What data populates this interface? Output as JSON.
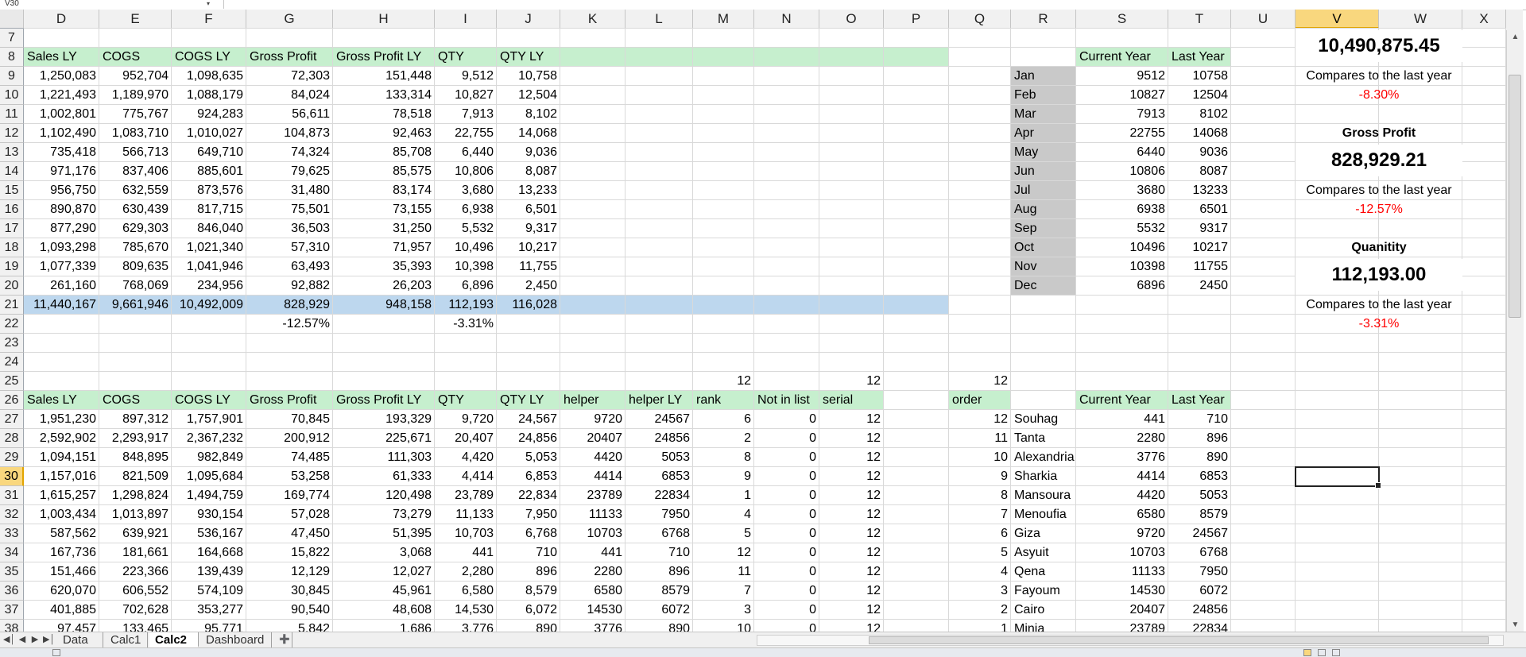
{
  "name_box": "V30",
  "columns": [
    "D",
    "E",
    "F",
    "G",
    "H",
    "I",
    "J",
    "K",
    "L",
    "M",
    "N",
    "O",
    "P",
    "Q",
    "R",
    "S",
    "T",
    "U",
    "V",
    "W",
    "X"
  ],
  "rows": [
    "7",
    "8",
    "9",
    "10",
    "11",
    "12",
    "13",
    "14",
    "15",
    "16",
    "17",
    "18",
    "19",
    "20",
    "21",
    "22",
    "23",
    "24",
    "25",
    "26",
    "27",
    "28",
    "29",
    "30",
    "31",
    "32",
    "33",
    "34",
    "35",
    "36",
    "37",
    "38"
  ],
  "active_cell": "V30",
  "colors": {
    "header_green": "#c6efce",
    "total_blue": "#bdd7ee",
    "month_gray": "#c9c9c9",
    "negative": "#ff0000"
  },
  "cells": {
    "D8": "Sales LY",
    "E8": "COGS",
    "F8": "COGS LY",
    "G8": "Gross Profit",
    "H8": "Gross Profit LY",
    "I8": "QTY",
    "J8": "QTY LY",
    "D9": "1,250,083",
    "E9": "952,704",
    "F9": "1,098,635",
    "G9": "72,303",
    "H9": "151,448",
    "I9": "9,512",
    "J9": "10,758",
    "D10": "1,221,493",
    "E10": "1,189,970",
    "F10": "1,088,179",
    "G10": "84,024",
    "H10": "133,314",
    "I10": "10,827",
    "J10": "12,504",
    "D11": "1,002,801",
    "E11": "775,767",
    "F11": "924,283",
    "G11": "56,611",
    "H11": "78,518",
    "I11": "7,913",
    "J11": "8,102",
    "D12": "1,102,490",
    "E12": "1,083,710",
    "F12": "1,010,027",
    "G12": "104,873",
    "H12": "92,463",
    "I12": "22,755",
    "J12": "14,068",
    "D13": "735,418",
    "E13": "566,713",
    "F13": "649,710",
    "G13": "74,324",
    "H13": "85,708",
    "I13": "6,440",
    "J13": "9,036",
    "D14": "971,176",
    "E14": "837,406",
    "F14": "885,601",
    "G14": "79,625",
    "H14": "85,575",
    "I14": "10,806",
    "J14": "8,087",
    "D15": "956,750",
    "E15": "632,559",
    "F15": "873,576",
    "G15": "31,480",
    "H15": "83,174",
    "I15": "3,680",
    "J15": "13,233",
    "D16": "890,870",
    "E16": "630,439",
    "F16": "817,715",
    "G16": "75,501",
    "H16": "73,155",
    "I16": "6,938",
    "J16": "6,501",
    "D17": "877,290",
    "E17": "629,303",
    "F17": "846,040",
    "G17": "36,503",
    "H17": "31,250",
    "I17": "5,532",
    "J17": "9,317",
    "D18": "1,093,298",
    "E18": "785,670",
    "F18": "1,021,340",
    "G18": "57,310",
    "H18": "71,957",
    "I18": "10,496",
    "J18": "10,217",
    "D19": "1,077,339",
    "E19": "809,635",
    "F19": "1,041,946",
    "G19": "63,493",
    "H19": "35,393",
    "I19": "10,398",
    "J19": "11,755",
    "D20": "261,160",
    "E20": "768,069",
    "F20": "234,956",
    "G20": "92,882",
    "H20": "26,203",
    "I20": "6,896",
    "J20": "2,450",
    "D21": "11,440,167",
    "E21": "9,661,946",
    "F21": "10,492,009",
    "G21": "828,929",
    "H21": "948,158",
    "I21": "112,193",
    "J21": "116,028",
    "G22": "-12.57%",
    "I22": "-3.31%",
    "M25": "12",
    "O25": "12",
    "Q25": "12",
    "D26": "Sales LY",
    "E26": "COGS",
    "F26": "COGS LY",
    "G26": "Gross Profit",
    "H26": "Gross Profit LY",
    "I26": "QTY",
    "J26": "QTY LY",
    "K26": "helper",
    "L26": "helper LY",
    "M26": "rank",
    "N26": "Not in list",
    "O26": "serial",
    "Q26": "order",
    "D27": "1,951,230",
    "E27": "897,312",
    "F27": "1,757,901",
    "G27": "70,845",
    "H27": "193,329",
    "I27": "9,720",
    "J27": "24,567",
    "K27": "9720",
    "L27": "24567",
    "M27": "6",
    "N27": "0",
    "O27": "12",
    "D28": "2,592,902",
    "E28": "2,293,917",
    "F28": "2,367,232",
    "G28": "200,912",
    "H28": "225,671",
    "I28": "20,407",
    "J28": "24,856",
    "K28": "20407",
    "L28": "24856",
    "M28": "2",
    "N28": "0",
    "O28": "12",
    "D29": "1,094,151",
    "E29": "848,895",
    "F29": "982,849",
    "G29": "74,485",
    "H29": "111,303",
    "I29": "4,420",
    "J29": "5,053",
    "K29": "4420",
    "L29": "5053",
    "M29": "8",
    "N29": "0",
    "O29": "12",
    "D30": "1,157,016",
    "E30": "821,509",
    "F30": "1,095,684",
    "G30": "53,258",
    "H30": "61,333",
    "I30": "4,414",
    "J30": "6,853",
    "K30": "4414",
    "L30": "6853",
    "M30": "9",
    "N30": "0",
    "O30": "12",
    "D31": "1,615,257",
    "E31": "1,298,824",
    "F31": "1,494,759",
    "G31": "169,774",
    "H31": "120,498",
    "I31": "23,789",
    "J31": "22,834",
    "K31": "23789",
    "L31": "22834",
    "M31": "1",
    "N31": "0",
    "O31": "12",
    "D32": "1,003,434",
    "E32": "1,013,897",
    "F32": "930,154",
    "G32": "57,028",
    "H32": "73,279",
    "I32": "11,133",
    "J32": "7,950",
    "K32": "11133",
    "L32": "7950",
    "M32": "4",
    "N32": "0",
    "O32": "12",
    "D33": "587,562",
    "E33": "639,921",
    "F33": "536,167",
    "G33": "47,450",
    "H33": "51,395",
    "I33": "10,703",
    "J33": "6,768",
    "K33": "10703",
    "L33": "6768",
    "M33": "5",
    "N33": "0",
    "O33": "12",
    "D34": "167,736",
    "E34": "181,661",
    "F34": "164,668",
    "G34": "15,822",
    "H34": "3,068",
    "I34": "441",
    "J34": "710",
    "K34": "441",
    "L34": "710",
    "M34": "12",
    "N34": "0",
    "O34": "12",
    "D35": "151,466",
    "E35": "223,366",
    "F35": "139,439",
    "G35": "12,129",
    "H35": "12,027",
    "I35": "2,280",
    "J35": "896",
    "K35": "2280",
    "L35": "896",
    "M35": "11",
    "N35": "0",
    "O35": "12",
    "D36": "620,070",
    "E36": "606,552",
    "F36": "574,109",
    "G36": "30,845",
    "H36": "45,961",
    "I36": "6,580",
    "J36": "8,579",
    "K36": "6580",
    "L36": "8579",
    "M36": "7",
    "N36": "0",
    "O36": "12",
    "D37": "401,885",
    "E37": "702,628",
    "F37": "353,277",
    "G37": "90,540",
    "H37": "48,608",
    "I37": "14,530",
    "J37": "6,072",
    "K37": "14530",
    "L37": "6072",
    "M37": "3",
    "N37": "0",
    "O37": "12",
    "D38": "97,457",
    "E38": "133,465",
    "F38": "95,771",
    "G38": "5,842",
    "H38": "1,686",
    "I38": "3,776",
    "J38": "890",
    "K38": "3776",
    "L38": "890",
    "M38": "10",
    "N38": "0",
    "O38": "12",
    "S8": "Current Year",
    "T8": "Last Year",
    "R9": "Jan",
    "S9": "9512",
    "T9": "10758",
    "R10": "Feb",
    "S10": "10827",
    "T10": "12504",
    "R11": "Mar",
    "S11": "7913",
    "T11": "8102",
    "R12": "Apr",
    "S12": "22755",
    "T12": "14068",
    "R13": "May",
    "S13": "6440",
    "T13": "9036",
    "R14": "Jun",
    "S14": "10806",
    "T14": "8087",
    "R15": "Jul",
    "S15": "3680",
    "T15": "13233",
    "R16": "Aug",
    "S16": "6938",
    "T16": "6501",
    "R17": "Sep",
    "S17": "5532",
    "T17": "9317",
    "R18": "Oct",
    "S18": "10496",
    "T18": "10217",
    "R19": "Nov",
    "S19": "10398",
    "T19": "11755",
    "R20": "Dec",
    "S20": "6896",
    "T20": "2450",
    "S26": "Current Year",
    "T26": "Last Year",
    "Q27": "12",
    "R27": "Souhag",
    "S27": "441",
    "T27": "710",
    "Q28": "11",
    "R28": "Tanta",
    "S28": "2280",
    "T28": "896",
    "Q29": "10",
    "R29": "Alexandria",
    "S29": "3776",
    "T29": "890",
    "Q30": "9",
    "R30": "Sharkia",
    "S30": "4414",
    "T30": "6853",
    "Q31": "8",
    "R31": "Mansoura",
    "S31": "4420",
    "T31": "5053",
    "Q32": "7",
    "R32": "Menoufia",
    "S32": "6580",
    "T32": "8579",
    "Q33": "6",
    "R33": "Giza",
    "S33": "9720",
    "T33": "24567",
    "Q34": "5",
    "R34": "Asyuit",
    "S34": "10703",
    "T34": "6768",
    "Q35": "4",
    "R35": "Qena",
    "S35": "11133",
    "T35": "7950",
    "Q36": "3",
    "R36": "Fayoum",
    "S36": "14530",
    "T36": "6072",
    "Q37": "2",
    "R37": "Cairo",
    "S37": "20407",
    "T37": "24856",
    "Q38": "1",
    "R38": "Minia",
    "S38": "23789",
    "T38": "22834"
  },
  "kpi": {
    "sales_value": "10,490,875.45",
    "sales_compare": "Compares to the last year",
    "sales_pct": "-8.30%",
    "gp_title": "Gross Profit",
    "gp_value": "828,929.21",
    "gp_compare": "Compares to the last year",
    "gp_pct": "-12.57%",
    "qty_title": "Quanitity",
    "qty_value": "112,193.00",
    "qty_compare": "Compares to the last year",
    "qty_pct": "-3.31%"
  },
  "tabs": [
    "Data",
    "Calc1",
    "Calc2",
    "Dashboard"
  ],
  "active_tab": "Calc2",
  "icons": {
    "tab_first": "first-sheet-icon",
    "tab_prev": "prev-sheet-icon",
    "tab_next": "next-sheet-icon",
    "tab_last": "last-sheet-icon",
    "insert_sheet": "insert-sheet-icon",
    "scroll_up": "scroll-up-icon",
    "scroll_down": "scroll-down-icon",
    "name_box_arrow": "dropdown-arrow-icon"
  }
}
